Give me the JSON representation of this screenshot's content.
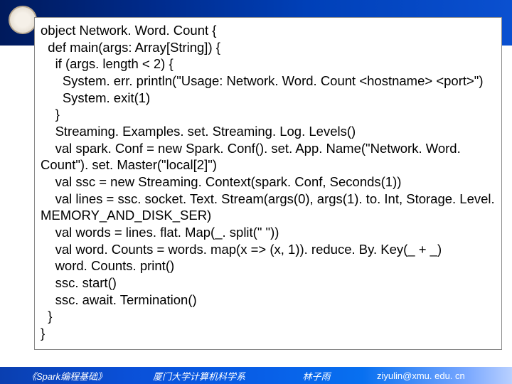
{
  "code": {
    "lines": [
      "object Network. Word. Count {",
      "  def main(args: Array[String]) {",
      "    if (args. length < 2) {",
      "      System. err. println(\"Usage: Network. Word. Count <hostname> <port>\")",
      "      System. exit(1)",
      "    }",
      "    Streaming. Examples. set. Streaming. Log. Levels()",
      "    val spark. Conf = new Spark. Conf(). set. App. Name(\"Network. Word. Count\"). set. Master(\"local[2]\")",
      "    val ssc = new Streaming. Context(spark. Conf, Seconds(1))",
      "    val lines = ssc. socket. Text. Stream(args(0), args(1). to. Int, Storage. Level. MEMORY_AND_DISK_SER)",
      "    val words = lines. flat. Map(_. split(\" \"))",
      "    val word. Counts = words. map(x => (x, 1)). reduce. By. Key(_ + _)",
      "    word. Counts. print()",
      "    ssc. start()",
      "    ssc. await. Termination()",
      "  }",
      "}"
    ]
  },
  "footer": {
    "book": "《Spark编程基础》",
    "dept": "厦门大学计算机科学系",
    "author": "林子雨",
    "email": "ziyulin@xmu. edu. cn"
  }
}
